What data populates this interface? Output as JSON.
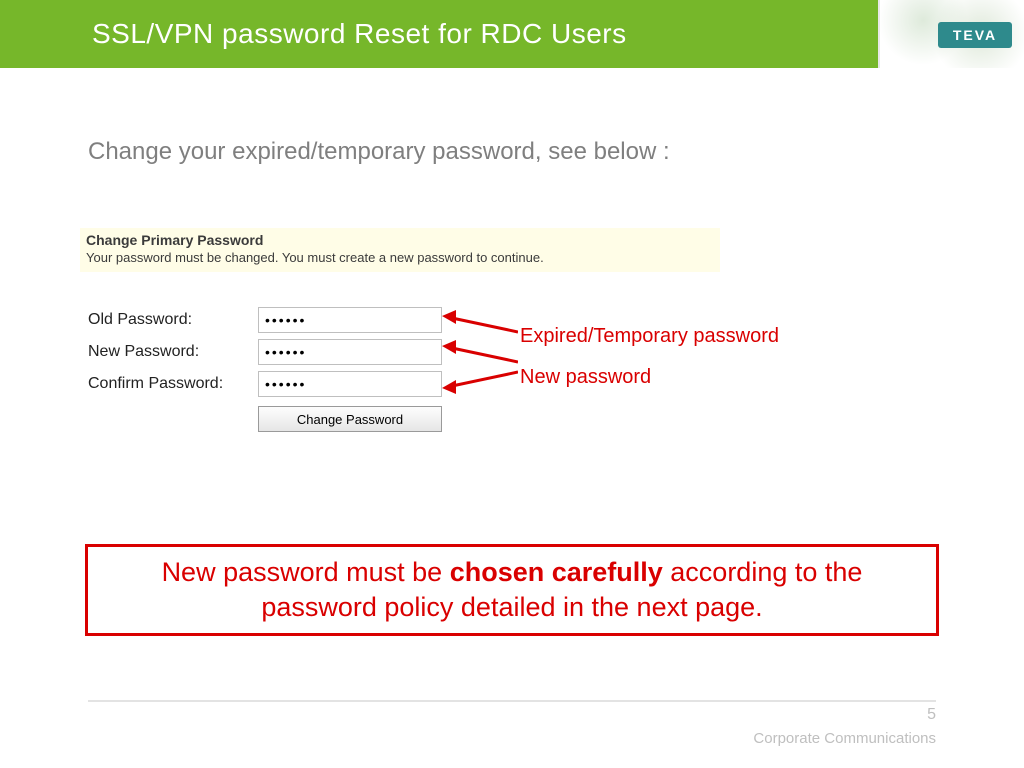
{
  "header": {
    "title": "SSL/VPN password Reset for RDC Users",
    "logo_text": "TEVA"
  },
  "intro": "Change your expired/temporary password, see below :",
  "panel": {
    "title": "Change Primary Password",
    "message": "Your password must be changed. You must create a new password to continue."
  },
  "form": {
    "old_label": "Old Password:",
    "new_label": "New Password:",
    "confirm_label": "Confirm Password:",
    "old_value": "••••••",
    "new_value": "••••••",
    "confirm_value": "••••••",
    "submit_label": "Change Password"
  },
  "annotations": {
    "a1": "Expired/Temporary password",
    "a2": "New password"
  },
  "notice": {
    "pre": "New password must be ",
    "bold": "chosen carefully",
    "post": " according to the password policy detailed in the next page."
  },
  "footer": {
    "text": "Corporate Communications",
    "page": "5"
  }
}
